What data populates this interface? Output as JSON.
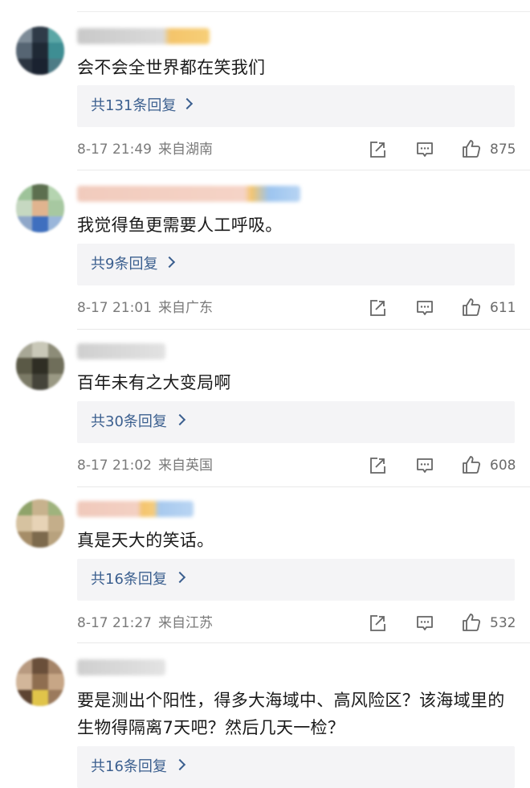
{
  "comments": [
    {
      "text": "会不会全世界都在笑我们",
      "replies_label": "共131条回复",
      "date": "8-17 21:49",
      "location": "来自湖南",
      "likes": "875"
    },
    {
      "text": "我觉得鱼更需要人工呼吸。",
      "replies_label": "共9条回复",
      "date": "8-17 21:01",
      "location": "来自广东",
      "likes": "611"
    },
    {
      "text": "百年未有之大变局啊",
      "replies_label": "共30条回复",
      "date": "8-17 21:02",
      "location": "来自英国",
      "likes": "608"
    },
    {
      "text": "真是天大的笑话。",
      "replies_label": "共16条回复",
      "date": "8-17 21:27",
      "location": "来自江苏",
      "likes": "532"
    },
    {
      "text": "要是测出个阳性，得多大海域中、高风险区？该海域里的生物得隔离7天吧？然后几天一检？",
      "replies_label": "共16条回复"
    }
  ],
  "icons": {
    "share": "share-icon",
    "comment": "comment-icon",
    "like": "thumbs-up-icon"
  },
  "colors": {
    "reply_link": "#3b5f8f",
    "meta_text": "#7a7a7a",
    "reply_box_bg": "#f4f4f6"
  }
}
